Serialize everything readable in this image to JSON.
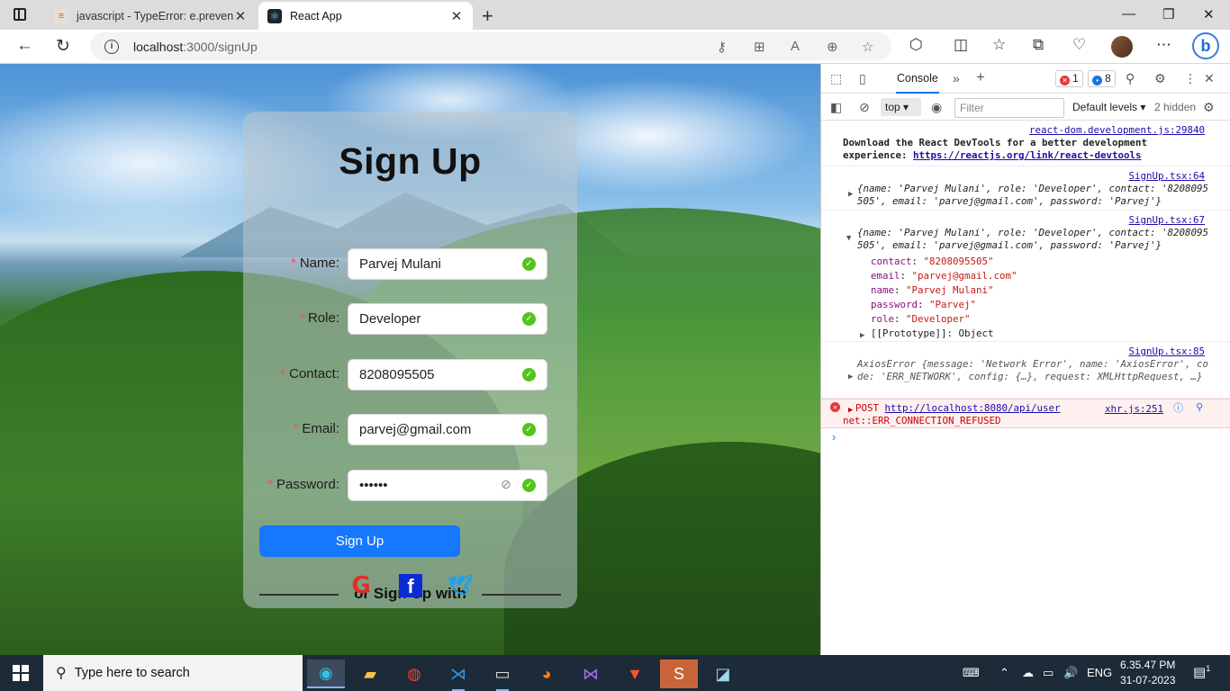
{
  "browser": {
    "tabs": [
      {
        "title": "javascript - TypeError: e.preventD",
        "active": false
      },
      {
        "title": "React App",
        "active": true
      }
    ],
    "address": {
      "host": "localhost",
      "path": ":3000/signUp"
    }
  },
  "signup": {
    "title": "Sign Up",
    "fields": [
      {
        "label": "Name",
        "value": "Parvej Mulani"
      },
      {
        "label": "Role",
        "value": "Developer"
      },
      {
        "label": "Contact",
        "value": "8208095505"
      },
      {
        "label": "Email",
        "value": "parvej@gmail.com"
      },
      {
        "label": "Password",
        "value": "••••••"
      }
    ],
    "submit_label": "Sign Up",
    "divider_text": "or Sign Up with"
  },
  "devtools": {
    "tab_label": "Console",
    "error_count": "1",
    "info_count": "8",
    "context": "top",
    "filter_placeholder": "Filter",
    "levels_label": "Default levels",
    "hidden_label": "2 hidden",
    "messages": {
      "m1_src": "react-dom.development.js:29840",
      "m1_text": "Download the React DevTools for a better development experience: ",
      "m1_link": "https://reactjs.org/link/react-devtools",
      "m2_src": "SignUp.tsx:64",
      "m2_obj": "{name: 'Parvej Mulani', role: 'Developer', contact: '8208095505', email: 'parvej@gmail.com', password: 'Parvej'}",
      "m3_src": "SignUp.tsx:67",
      "m3_obj": "{name: 'Parvej Mulani', role: 'Developer', contact: '8208095505', email: 'parvej@gmail.com', password: 'Parvej'}",
      "m3_props": [
        {
          "key": "contact",
          "value": "\"8208095505\""
        },
        {
          "key": "email",
          "value": "\"parvej@gmail.com\""
        },
        {
          "key": "name",
          "value": "\"Parvej Mulani\""
        },
        {
          "key": "password",
          "value": "\"Parvej\""
        },
        {
          "key": "role",
          "value": "\"Developer\""
        }
      ],
      "m3_proto": "[[Prototype]]: Object",
      "m4_src": "SignUp.tsx:85",
      "m4_obj": "AxiosError {message: 'Network Error', name: 'AxiosError', code: 'ERR_NETWORK', config: {…}, request: XMLHttpRequest, …}",
      "m5_method": "POST",
      "m5_url": "http://localhost:8080/api/user",
      "m5_src": "xhr.js:251",
      "m5_detail": "net::ERR_CONNECTION_REFUSED"
    }
  },
  "taskbar": {
    "search_placeholder": "Type here to search",
    "lang": "ENG",
    "time": "6.35.47 PM",
    "date": "31-07-2023",
    "notification_count": "1"
  }
}
